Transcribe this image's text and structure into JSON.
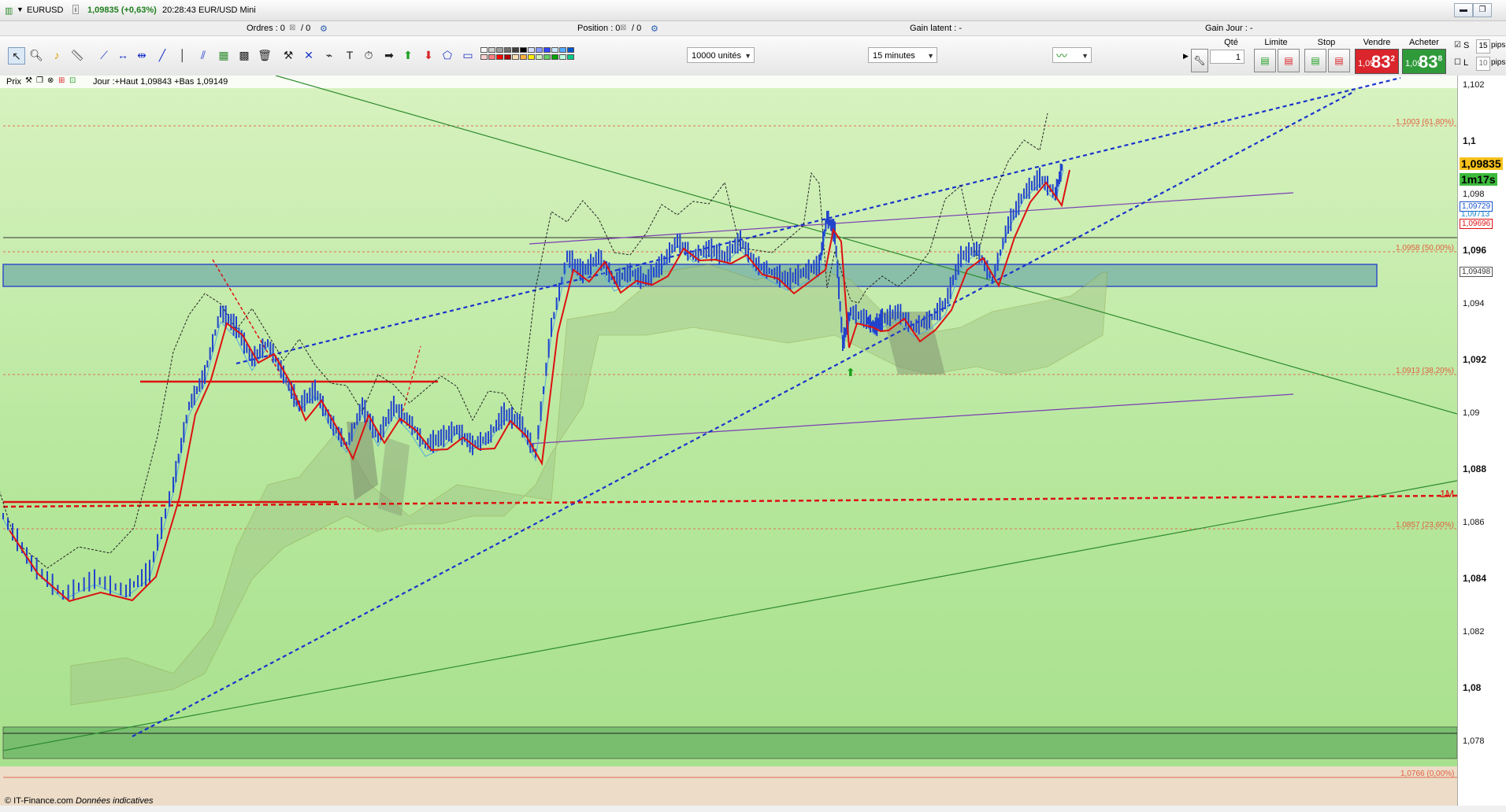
{
  "window": {
    "instrument": "EURUSD",
    "last_price": "1,09835 (+0,63%)",
    "time": "20:28:43",
    "product": "EUR/USD Mini"
  },
  "info_bar": {
    "orders": "Ordres : 0",
    "orders_count": "/ 0",
    "position": "Position : 0",
    "position_count": "/ 0",
    "latent_gain": "Gain latent : -",
    "day_gain": "Gain Jour : -"
  },
  "toolbar": {
    "quantity_select": "10000 unités",
    "interval_select": "15 minutes"
  },
  "order_panel": {
    "qty_label": "Qté",
    "qty_value": "1",
    "limit_label": "Limite",
    "stop_label": "Stop",
    "sell_label": "Vendre",
    "buy_label": "Acheter",
    "sell_price_prefix": "1,09",
    "sell_price_main": "83",
    "sell_price_sup": "2",
    "buy_price_prefix": "1,09",
    "buy_price_main": "83",
    "buy_price_sup": "8",
    "s_label": "S",
    "l_label": "L",
    "s_pips_value": "15",
    "l_pips_value": "10",
    "pips_label": "pips",
    "sell_color": "#d9252b",
    "buy_color": "#2f9a3a"
  },
  "chart_legend": {
    "prix_label": "Prix",
    "day_info": "Jour :+Haut 1,09843 +Bas 1,09149"
  },
  "price_axis": {
    "ticks": [
      "1,102",
      "1,1",
      "1,098",
      "1,096",
      "1,094",
      "1,092",
      "1,09",
      "1,088",
      "1,086",
      "1,084",
      "1,082",
      "1,08",
      "1,078"
    ],
    "current_price": "1,09835",
    "countdown": "1m17s",
    "tag_1": "1,09729",
    "tag_2": "1,09713",
    "tag_3": "1,09696",
    "tag_4": "1,09498"
  },
  "fibonacci": {
    "f618": "1,1003 (61,80%)",
    "f50": "1,0958 (50,00%)",
    "f382": "1,0913 (38,20%)",
    "f236": "1,0857 (23,60%)",
    "f0": "1,0766 (0,00%)"
  },
  "annotations": {
    "monthly_label": "1M"
  },
  "footer": {
    "source": "© IT-Finance.com",
    "note": "Données indicatives"
  },
  "colors": {
    "chart_bg_top": "#d6f1bc",
    "chart_bg_bottom": "#a4e08a",
    "candles": "#2244cc",
    "trend_blue": "#1a33cc",
    "kijun_red": "#dd1111",
    "trendline_green": "#2e8b2e",
    "channel_purple": "#7a3fb3",
    "zone_teal": "#7fb8a8"
  }
}
